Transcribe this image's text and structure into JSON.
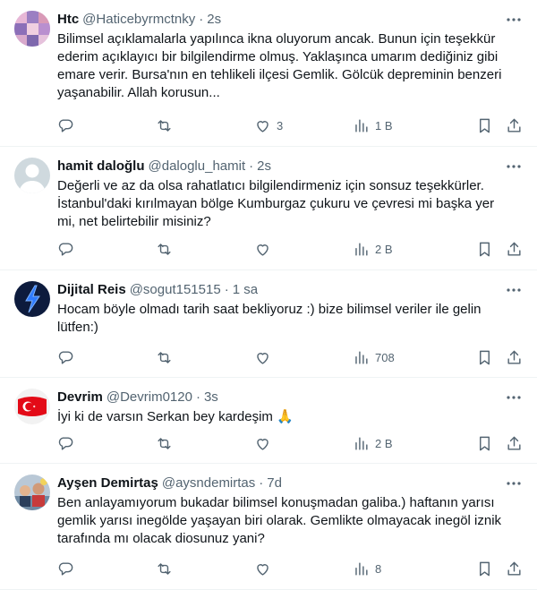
{
  "tweets": [
    {
      "name": "Htc",
      "handle": "@Haticebyrmctnky",
      "time": "2s",
      "text": "Bilimsel açıklamalarla yapılınca ikna oluyorum ancak. Bunun için teşekkür\nederim açıklayıcı bir bilgilendirme olmuş. Yaklaşınca umarım dediğiniz gibi\nemare verir. Bursa'nın en tehlikeli ilçesi Gemlik. Gölcük depreminin benzeri\nyaşanabilir. Allah korusun...",
      "replies": "",
      "retweets": "",
      "likes": "3",
      "views": "1 B",
      "avatar": "mosaic-pink",
      "avatar_color": "#b784c9"
    },
    {
      "name": "hamit daloğlu",
      "handle": "@daloglu_hamit",
      "time": "2s",
      "text": "Değerli ve az da olsa rahatlatıcı bilgilendirmeniz için sonsuz teşekkürler.\nİstanbul'daki kırılmayan bölge Kumburgaz çukuru ve çevresi mi başka yer\nmi, net belirtebilir misiniz?",
      "replies": "",
      "retweets": "",
      "likes": "",
      "views": "2 B",
      "avatar": "default-person",
      "avatar_color": "#cfd9de"
    },
    {
      "name": "Dijital Reis",
      "handle": "@sogut151515",
      "time": "1 sa",
      "text": "Hocam böyle olmadı tarih saat bekliyoruz :) bize bilimsel veriler ile gelin\nlütfen:)",
      "replies": "",
      "retweets": "",
      "likes": "",
      "views": "708",
      "avatar": "lightning-blue",
      "avatar_color": "#0d1b3d"
    },
    {
      "name": "Devrim",
      "handle": "@Devrim0120",
      "time": "3s",
      "text": "İyi ki de varsın Serkan bey kardeşim 🙏",
      "replies": "",
      "retweets": "",
      "likes": "",
      "views": "2 B",
      "avatar": "turkey-flag",
      "avatar_color": "#e30a17"
    },
    {
      "name": "Ayşen Demirtaş",
      "handle": "@aysndemirtas",
      "time": "7d",
      "text": "Ben anlayamıyorum bukadar bilimsel konuşmadan galiba.)  haftanın yarısı\ngemlik yarısı inegölde  yaşayan biri olarak. Gemlikte olmayacak inegöl iznik\ntarafında mı olacak diosunuz yani?",
      "replies": "",
      "retweets": "",
      "likes": "",
      "views": "8",
      "avatar": "photo-group",
      "avatar_color": "#9fb4c8"
    }
  ],
  "separator": "·"
}
